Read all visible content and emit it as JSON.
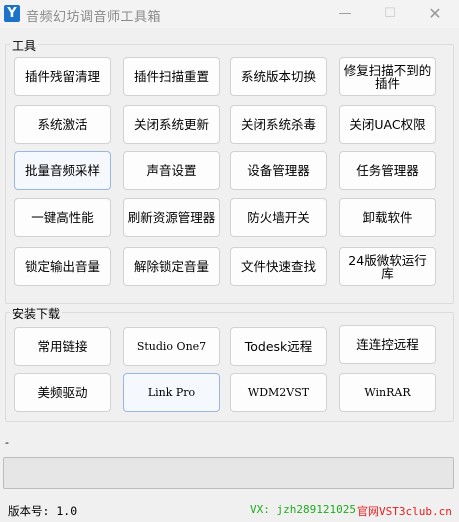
{
  "window": {
    "title": "音频幻坊调音师工具箱",
    "icon_letter": "Y",
    "min_glyph": "—",
    "max_glyph": "☐",
    "close_glyph": "✕"
  },
  "tools": {
    "label": "工具",
    "buttons": [
      "插件残留清理",
      "插件扫描重置",
      "系统版本切换",
      "修复扫描不到的插件",
      "系统激活",
      "关闭系统更新",
      "关闭系统杀毒",
      "关闭UAC权限",
      "批量音频采样",
      "声音设置",
      "设备管理器",
      "任务管理器",
      "一键高性能",
      "刷新资源管理器",
      "防火墙开关",
      "卸载软件",
      "锁定输出音量",
      "解除锁定音量",
      "文件快速查找",
      "24版微软运行库"
    ]
  },
  "downloads": {
    "label": "安装下载",
    "buttons": [
      "常用链接",
      "Studio One7",
      "Todesk远程",
      "连连控远程",
      "美频驱动",
      "Link Pro",
      "WDM2VST",
      "WinRAR"
    ]
  },
  "progress": {
    "marker": "-",
    "value": 0
  },
  "status": {
    "version": "版本号: 1.0",
    "wechat": "VX: jzh289121025",
    "site": "官网VST3club.cn"
  }
}
